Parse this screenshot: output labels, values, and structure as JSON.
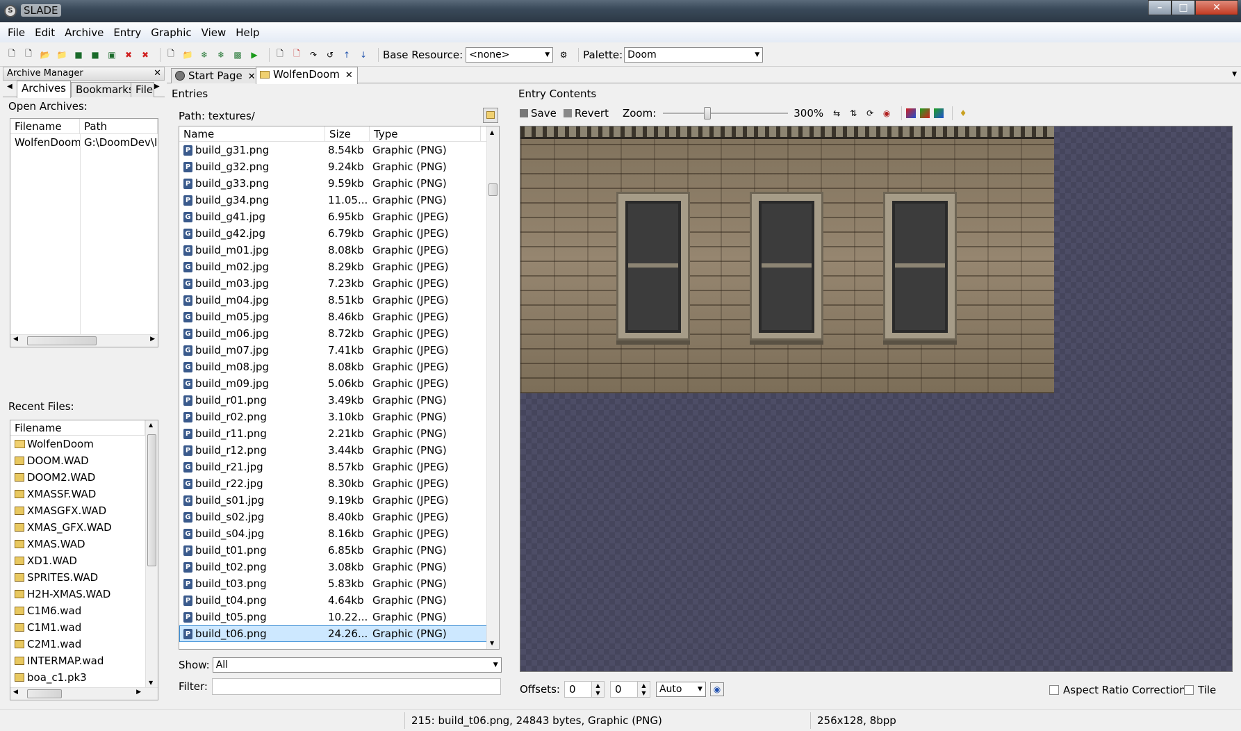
{
  "window": {
    "title": "SLADE"
  },
  "menu": [
    "File",
    "Edit",
    "Archive",
    "Entry",
    "Graphic",
    "View",
    "Help"
  ],
  "toolbar": {
    "base_resource_label": "Base Resource:",
    "base_resource_value": "<none>",
    "palette_label": "Palette:",
    "palette_value": "Doom"
  },
  "archive_manager": {
    "caption": "Archive Manager",
    "tabs": [
      "Archives",
      "Bookmarks",
      "File"
    ],
    "open_archives_label": "Open Archives:",
    "open_columns": [
      "Filename",
      "Path"
    ],
    "open_rows": [
      {
        "filename": "WolfenDoom",
        "path": "G:\\DoomDev\\Pr"
      }
    ],
    "recent_label": "Recent Files:",
    "recent_column": "Filename",
    "recent": [
      {
        "name": "WolfenDoom",
        "icon": "folder-icon"
      },
      {
        "name": "DOOM.WAD",
        "icon": "wad-icon"
      },
      {
        "name": "DOOM2.WAD",
        "icon": "wad-icon"
      },
      {
        "name": "XMASSF.WAD",
        "icon": "wad-icon"
      },
      {
        "name": "XMASGFX.WAD",
        "icon": "wad-icon"
      },
      {
        "name": "XMAS_GFX.WAD",
        "icon": "wad-icon"
      },
      {
        "name": "XMAS.WAD",
        "icon": "wad-icon"
      },
      {
        "name": "XD1.WAD",
        "icon": "wad-icon"
      },
      {
        "name": "SPRITES.WAD",
        "icon": "wad-icon"
      },
      {
        "name": "H2H-XMAS.WAD",
        "icon": "wad-icon"
      },
      {
        "name": "C1M6.wad",
        "icon": "wad-icon"
      },
      {
        "name": "C1M1.wad",
        "icon": "wad-icon"
      },
      {
        "name": "C2M1.wad",
        "icon": "wad-icon"
      },
      {
        "name": "INTERMAP.wad",
        "icon": "wad-icon"
      },
      {
        "name": "boa_c1.pk3",
        "icon": "zip-icon"
      }
    ]
  },
  "tabs": [
    "Start Page",
    "WolfenDoom"
  ],
  "entries": {
    "caption": "Entries",
    "path": "Path: textures/",
    "columns": [
      "Name",
      "Size",
      "Type"
    ],
    "rows": [
      {
        "icon": "P",
        "name": "build_g31.png",
        "size": "8.54kb",
        "type": "Graphic (PNG)"
      },
      {
        "icon": "P",
        "name": "build_g32.png",
        "size": "9.24kb",
        "type": "Graphic (PNG)"
      },
      {
        "icon": "P",
        "name": "build_g33.png",
        "size": "9.59kb",
        "type": "Graphic (PNG)"
      },
      {
        "icon": "P",
        "name": "build_g34.png",
        "size": "11.05...",
        "type": "Graphic (PNG)"
      },
      {
        "icon": "G",
        "name": "build_g41.jpg",
        "size": "6.95kb",
        "type": "Graphic (JPEG)"
      },
      {
        "icon": "G",
        "name": "build_g42.jpg",
        "size": "6.79kb",
        "type": "Graphic (JPEG)"
      },
      {
        "icon": "G",
        "name": "build_m01.jpg",
        "size": "8.08kb",
        "type": "Graphic (JPEG)"
      },
      {
        "icon": "G",
        "name": "build_m02.jpg",
        "size": "8.29kb",
        "type": "Graphic (JPEG)"
      },
      {
        "icon": "G",
        "name": "build_m03.jpg",
        "size": "7.23kb",
        "type": "Graphic (JPEG)"
      },
      {
        "icon": "G",
        "name": "build_m04.jpg",
        "size": "8.51kb",
        "type": "Graphic (JPEG)"
      },
      {
        "icon": "G",
        "name": "build_m05.jpg",
        "size": "8.46kb",
        "type": "Graphic (JPEG)"
      },
      {
        "icon": "G",
        "name": "build_m06.jpg",
        "size": "8.72kb",
        "type": "Graphic (JPEG)"
      },
      {
        "icon": "G",
        "name": "build_m07.jpg",
        "size": "7.41kb",
        "type": "Graphic (JPEG)"
      },
      {
        "icon": "G",
        "name": "build_m08.jpg",
        "size": "8.08kb",
        "type": "Graphic (JPEG)"
      },
      {
        "icon": "G",
        "name": "build_m09.jpg",
        "size": "5.06kb",
        "type": "Graphic (JPEG)"
      },
      {
        "icon": "P",
        "name": "build_r01.png",
        "size": "3.49kb",
        "type": "Graphic (PNG)"
      },
      {
        "icon": "P",
        "name": "build_r02.png",
        "size": "3.10kb",
        "type": "Graphic (PNG)"
      },
      {
        "icon": "P",
        "name": "build_r11.png",
        "size": "2.21kb",
        "type": "Graphic (PNG)"
      },
      {
        "icon": "P",
        "name": "build_r12.png",
        "size": "3.44kb",
        "type": "Graphic (PNG)"
      },
      {
        "icon": "G",
        "name": "build_r21.jpg",
        "size": "8.57kb",
        "type": "Graphic (JPEG)"
      },
      {
        "icon": "G",
        "name": "build_r22.jpg",
        "size": "8.30kb",
        "type": "Graphic (JPEG)"
      },
      {
        "icon": "G",
        "name": "build_s01.jpg",
        "size": "9.19kb",
        "type": "Graphic (JPEG)"
      },
      {
        "icon": "G",
        "name": "build_s02.jpg",
        "size": "8.40kb",
        "type": "Graphic (JPEG)"
      },
      {
        "icon": "G",
        "name": "build_s04.jpg",
        "size": "8.16kb",
        "type": "Graphic (JPEG)"
      },
      {
        "icon": "P",
        "name": "build_t01.png",
        "size": "6.85kb",
        "type": "Graphic (PNG)"
      },
      {
        "icon": "P",
        "name": "build_t02.png",
        "size": "3.08kb",
        "type": "Graphic (PNG)"
      },
      {
        "icon": "P",
        "name": "build_t03.png",
        "size": "5.83kb",
        "type": "Graphic (PNG)"
      },
      {
        "icon": "P",
        "name": "build_t04.png",
        "size": "4.64kb",
        "type": "Graphic (PNG)"
      },
      {
        "icon": "P",
        "name": "build_t05.png",
        "size": "10.22...",
        "type": "Graphic (PNG)"
      },
      {
        "icon": "P",
        "name": "build_t06.png",
        "size": "24.26...",
        "type": "Graphic (PNG)",
        "selected": true
      }
    ],
    "show_label": "Show:",
    "show_value": "All",
    "filter_label": "Filter:",
    "filter_value": ""
  },
  "entry_contents": {
    "caption": "Entry Contents",
    "save": "Save",
    "revert": "Revert",
    "zoom_label": "Zoom:",
    "zoom_value": "300%",
    "zoom_fraction": 0.35,
    "offsets_label": "Offsets:",
    "offset_x": "0",
    "offset_y": "0",
    "offset_mode": "Auto",
    "aspect_label": "Aspect Ratio Correction",
    "tile_label": "Tile"
  },
  "status": {
    "left": "215: build_t06.png, 24843 bytes, Graphic (PNG)",
    "right": "256x128, 8bpp"
  }
}
